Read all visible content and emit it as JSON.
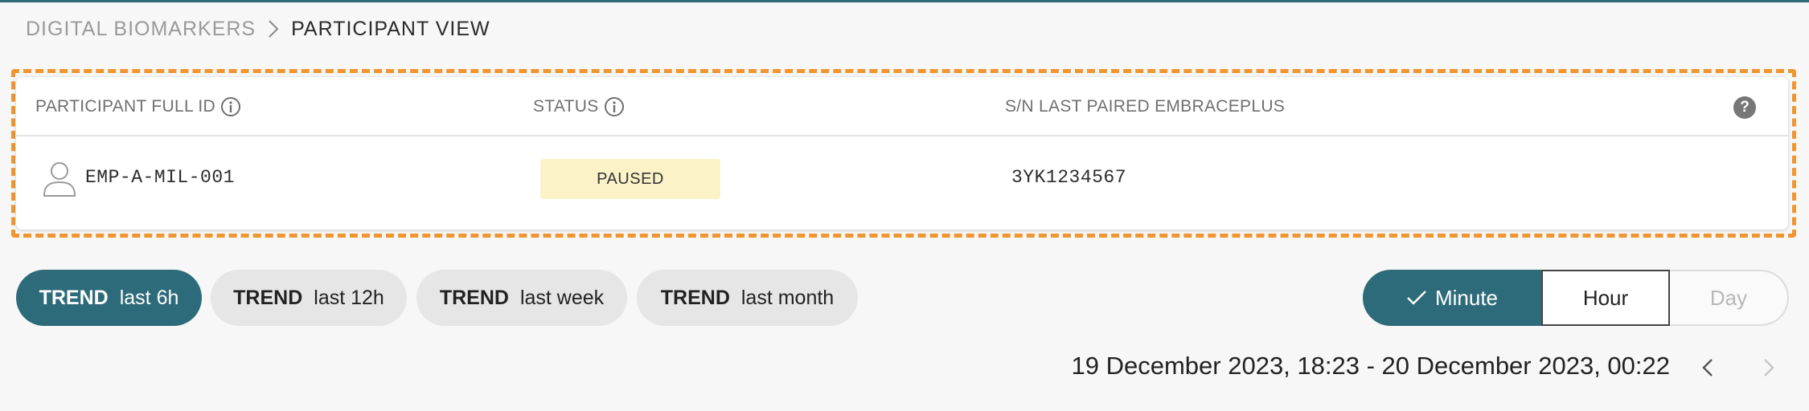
{
  "breadcrumb": {
    "parent": "DIGITAL BIOMARKERS",
    "current": "PARTICIPANT VIEW"
  },
  "table": {
    "headers": {
      "participant_id": "PARTICIPANT FULL ID",
      "status": "STATUS",
      "serial": "S/N LAST PAIRED EMBRACEPLUS"
    },
    "help_label": "?",
    "row": {
      "participant_id": "EMP-A-MIL-001",
      "status": "PAUSED",
      "serial": "3YK1234567"
    }
  },
  "trends": [
    {
      "prefix": "TREND",
      "label": "last 6h",
      "active": true
    },
    {
      "prefix": "TREND",
      "label": "last 12h",
      "active": false
    },
    {
      "prefix": "TREND",
      "label": "last week",
      "active": false
    },
    {
      "prefix": "TREND",
      "label": "last month",
      "active": false
    }
  ],
  "resolution": {
    "options": [
      "Minute",
      "Hour",
      "Day"
    ],
    "selected": "Minute",
    "disabled": [
      "Day"
    ]
  },
  "date_range": "19 December 2023, 18:23 - 20 December 2023, 00:22",
  "icons": {
    "info": "info-icon",
    "help": "help-icon",
    "avatar": "user-icon",
    "check": "check-icon",
    "prev": "chevron-left-icon",
    "next": "chevron-right-icon",
    "separator": "chevron-right-icon"
  },
  "colors": {
    "accent": "#2e6b7a",
    "highlight": "#f0952f",
    "status_paused_bg": "#fbf3c7"
  }
}
